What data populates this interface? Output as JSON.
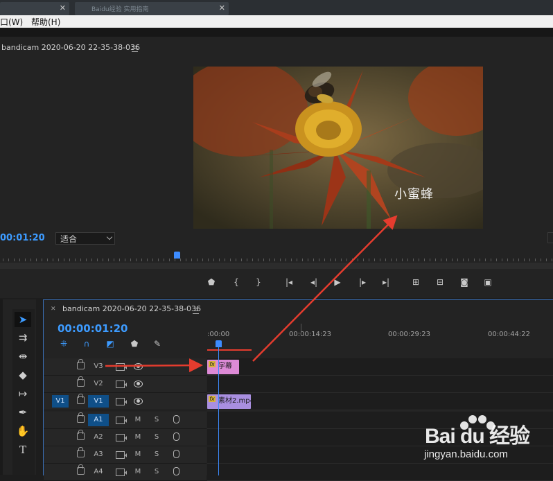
{
  "menu": {
    "window_label": "口(W)",
    "help_label": "帮助(H)"
  },
  "browser_tab": {
    "title": "Baidu经验 实用指南"
  },
  "monitor": {
    "title": "bandicam 2020-06-20 22-35-38-036",
    "caption": "小蜜蜂",
    "timecode": "00:01:20",
    "fit_value": "适合",
    "transport": [
      "marker-icon",
      "mark-in-icon",
      "mark-out-icon",
      "go-to-in-icon",
      "step-back-icon",
      "play-icon",
      "step-forward-icon",
      "go-to-out-icon",
      "insert-icon",
      "overwrite-icon",
      "export-frame-icon",
      "compare-icon"
    ]
  },
  "tools": [
    "selection-tool-icon",
    "track-select-icon",
    "ripple-edit-icon",
    "razor-icon",
    "slip-icon",
    "pen-icon",
    "hand-icon",
    "type-tool-icon"
  ],
  "timeline": {
    "title": "bandicam 2020-06-20 22-35-38-036",
    "timecode": "00:00:01:20",
    "ruler": [
      ":00:00",
      "00:00:14:23",
      "00:00:29:23",
      "00:00:44:22"
    ],
    "tracks": [
      {
        "source": "",
        "name": "V3",
        "kind": "video",
        "selected": false
      },
      {
        "source": "",
        "name": "V2",
        "kind": "video",
        "selected": false
      },
      {
        "source": "V1",
        "name": "V1",
        "kind": "video",
        "selected": false
      },
      {
        "source": "",
        "name": "A1",
        "kind": "audio",
        "selected": true
      },
      {
        "source": "",
        "name": "A2",
        "kind": "audio",
        "selected": false
      },
      {
        "source": "",
        "name": "A3",
        "kind": "audio",
        "selected": false
      },
      {
        "source": "",
        "name": "A4",
        "kind": "audio",
        "selected": false
      }
    ],
    "audio_buttons": {
      "mute": "M",
      "solo": "S"
    },
    "clips": {
      "v3_label": "字幕",
      "v1_label": "素材2.mp4",
      "fx": "fx"
    }
  },
  "watermark": {
    "logo": "Bai du 经验",
    "url": "jingyan.baidu.com"
  },
  "colors": {
    "accent_blue": "#3d9bff",
    "title_clip": "#dd8ad6",
    "video_clip": "#a98fe0",
    "annotation": "#e53c2e"
  }
}
